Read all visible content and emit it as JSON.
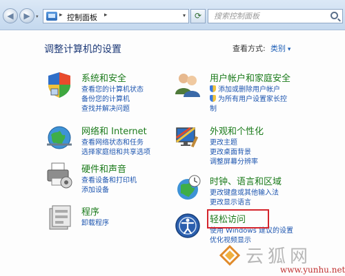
{
  "address_bar": {
    "breadcrumb": "控制面板",
    "back_glyph": "◀",
    "forward_glyph": "▶",
    "sep_glyph": "▸",
    "drop_glyph": "▾",
    "refresh_glyph": "⟳"
  },
  "search": {
    "placeholder": "搜索控制面板"
  },
  "header": {
    "title": "调整计算机的设置",
    "view_by_label": "查看方式:",
    "view_by_value": "类别"
  },
  "categories": {
    "system": {
      "title": "系统和安全",
      "links": [
        "查看您的计算机状态",
        "备份您的计算机",
        "查找并解决问题"
      ]
    },
    "network": {
      "title": "网络和 Internet",
      "links": [
        "查看网络状态和任务",
        "选择家庭组和共享选项"
      ]
    },
    "hardware": {
      "title": "硬件和声音",
      "links": [
        "查看设备和打印机",
        "添加设备"
      ]
    },
    "programs": {
      "title": "程序",
      "links": [
        "卸载程序"
      ]
    },
    "users": {
      "title": "用户帐户和家庭安全",
      "links": [
        "添加或删除用户帐户",
        "为所有用户设置家长控",
        "制"
      ]
    },
    "appearance": {
      "title": "外观和个性化",
      "links": [
        "更改主题",
        "更改桌面背景",
        "调整屏幕分辨率"
      ]
    },
    "clock": {
      "title": "时钟、语言和区域",
      "links": [
        "更改键盘或其他输入法",
        "更改显示语言"
      ]
    },
    "ease": {
      "title": "轻松访问",
      "links": [
        "使用 Windows 建议的设置",
        "优化视频显示"
      ]
    }
  },
  "watermark": {
    "text": "云狐网",
    "url": "www.yunhu.net"
  },
  "colors": {
    "category_title": "#1a7a1a",
    "link": "#1e56b0",
    "highlight": "#d4232b"
  }
}
